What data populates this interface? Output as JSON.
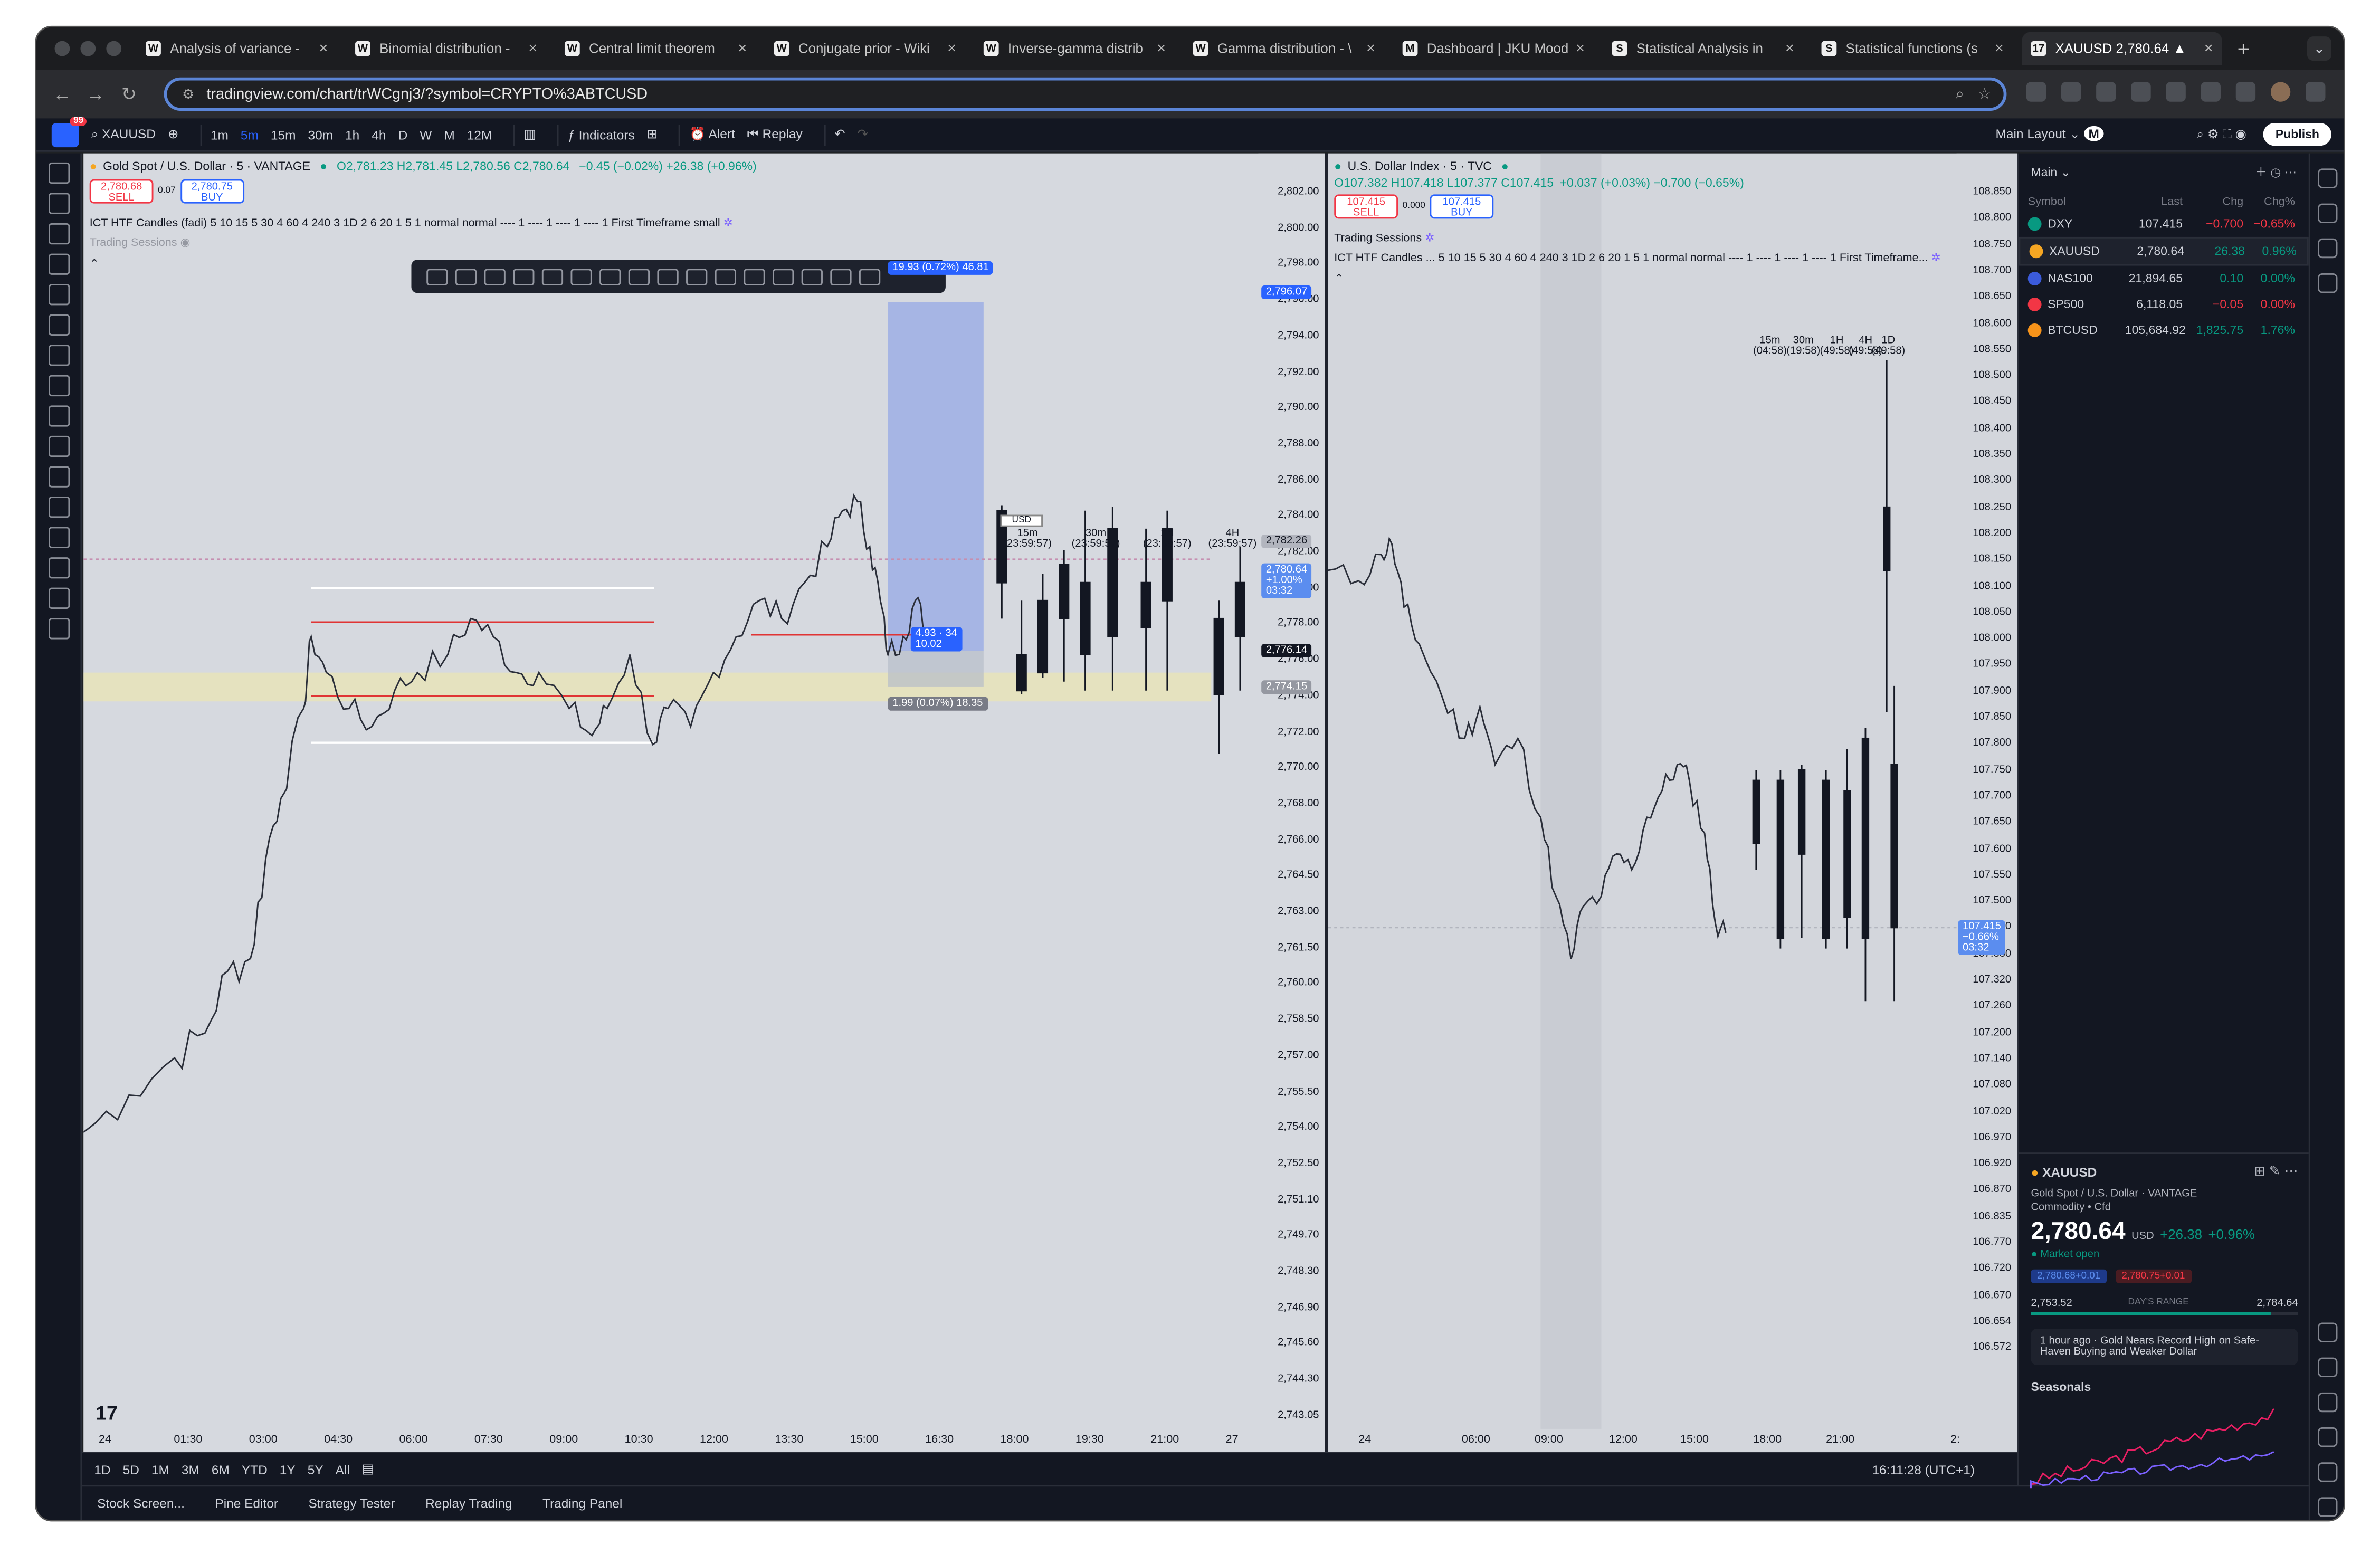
{
  "browser": {
    "tabs": [
      {
        "label": "Analysis of variance -",
        "fav": "W"
      },
      {
        "label": "Binomial distribution -",
        "fav": "W"
      },
      {
        "label": "Central limit theorem",
        "fav": "W"
      },
      {
        "label": "Conjugate prior - Wiki",
        "fav": "W"
      },
      {
        "label": "Inverse-gamma distrib",
        "fav": "W"
      },
      {
        "label": "Gamma distribution - \\",
        "fav": "W"
      },
      {
        "label": "Dashboard | JKU Mood",
        "fav": "M"
      },
      {
        "label": "Statistical Analysis in",
        "fav": "S"
      },
      {
        "label": "Statistical functions (s",
        "fav": "S"
      },
      {
        "label": "XAUUSD 2,780.64 ▲",
        "fav": "17"
      }
    ],
    "new_tab_icon": "+",
    "url": "tradingview.com/chart/trWCgnj3/?symbol=CRYPTO%3ABTCUSD"
  },
  "topbar": {
    "symbol": "XAUUSD",
    "timeframes": [
      "1m",
      "5m",
      "15m",
      "30m",
      "1h",
      "4h",
      "D",
      "W",
      "M",
      "12M"
    ],
    "selected_tf": "5m",
    "indicators": "Indicators",
    "alert": "Alert",
    "replay": "Replay",
    "layout": "Main Layout",
    "layout_badge": "M",
    "publish": "Publish",
    "notif_count": "99"
  },
  "chartL": {
    "title": "Gold Spot / U.S. Dollar · 5 · VANTAGE",
    "ohlc": "O2,781.23 H2,781.45 L2,780.56 C2,780.64",
    "change": "−0.45 (−0.02%) +26.38 (+0.96%)",
    "sell_price": "2,780.68",
    "sell": "SELL",
    "buy_price": "2,780.75",
    "buy": "BUY",
    "spread": "0.07",
    "indicator": "ICT HTF Candles (fadi)",
    "indicator_args": "5 10 15 5 30 4 60 4 240 3 1D 2 6 20 1 5 1 normal normal ---- 1 ---- 1 ---- 1 ---- 1 First Timeframe small",
    "sessions": "Trading Sessions",
    "currency": "USD",
    "price_scale": [
      "2,802.00",
      "2,800.00",
      "2,798.00",
      "2,796.00",
      "2,794.00",
      "2,792.00",
      "2,790.00",
      "2,788.00",
      "2,786.00",
      "2,784.00",
      "2,782.00",
      "2,780.00",
      "2,778.00",
      "2,776.00",
      "2,774.00",
      "2,772.00",
      "2,770.00",
      "2,768.00",
      "2,766.00",
      "2,764.50",
      "2,763.00",
      "2,761.50",
      "2,760.00",
      "2,758.50",
      "2,757.00",
      "2,755.50",
      "2,754.00",
      "2,752.50",
      "2,751.10",
      "2,749.70",
      "2,748.30",
      "2,746.90",
      "2,745.60",
      "2,744.30",
      "2,743.05"
    ],
    "time_axis": [
      "24",
      "01:30",
      "03:00",
      "04:30",
      "06:00",
      "07:30",
      "09:00",
      "10:30",
      "12:00",
      "13:30",
      "15:00",
      "16:30",
      "18:00",
      "19:30",
      "21:00",
      "27"
    ],
    "htf_labels": [
      {
        "tf": "15m",
        "t": "(23:59:57)"
      },
      {
        "tf": "30m",
        "t": "(23:59:57)"
      },
      {
        "tf": "1H",
        "t": "(23:59:57)"
      },
      {
        "tf": "4H",
        "t": "(23:59:57)"
      }
    ],
    "tags": {
      "p1": "2,796.07",
      "p2": "2,782.26",
      "last": "2,780.64",
      "last_chg": "+1.00%",
      "last_t": "03:32",
      "p3": "2,776.14",
      "p4": "2,774.15"
    },
    "pos_top": "19.93 (0.72%) 46.81",
    "pos_mid": "4.93 · 34\n10.02",
    "pos_bot": "1.99 (0.07%) 18.35"
  },
  "chartR": {
    "title": "U.S. Dollar Index · 5 · TVC",
    "ohlc": "O107.382 H107.418 L107.377 C107.415",
    "change": "+0.037 (+0.03%) −0.700 (−0.65%)",
    "sell_price": "107.415",
    "sell": "SELL",
    "buy_price": "107.415",
    "buy": "BUY",
    "spread": "0.000",
    "sessions": "Trading Sessions",
    "indicator": "ICT HTF Candles ...",
    "indicator_args": "5 10 15 5 30 4 60 4 240 3 1D 2 6 20 1 5 1 normal normal ---- 1 ---- 1 ---- 1 ---- 1 First Timeframe...",
    "currency": "USD",
    "price_scale": [
      "108.850",
      "108.800",
      "108.750",
      "108.700",
      "108.650",
      "108.600",
      "108.550",
      "108.500",
      "108.450",
      "108.400",
      "108.350",
      "108.300",
      "108.250",
      "108.200",
      "108.150",
      "108.100",
      "108.050",
      "108.000",
      "107.950",
      "107.900",
      "107.850",
      "107.800",
      "107.750",
      "107.700",
      "107.650",
      "107.600",
      "107.550",
      "107.500",
      "107.440",
      "107.380",
      "107.320",
      "107.260",
      "107.200",
      "107.140",
      "107.080",
      "107.020",
      "106.970",
      "106.920",
      "106.870",
      "106.835",
      "106.770",
      "106.720",
      "106.670",
      "106.654",
      "106.572"
    ],
    "time_axis": [
      "24",
      "06:00",
      "09:00",
      "12:00",
      "15:00",
      "18:00",
      "21:00",
      "2:"
    ],
    "htf_labels": [
      {
        "tf": "15m",
        "t": "(04:58)"
      },
      {
        "tf": "30m",
        "t": "(19:58)"
      },
      {
        "tf": "1H",
        "t": "(49:58)"
      },
      {
        "tf": "4H",
        "t": "(49:58)"
      },
      {
        "tf": "1D",
        "t": "(49:58)"
      }
    ],
    "tags": {
      "last": "107.415",
      "last_chg": "−0.66%",
      "last_t": "03:32"
    }
  },
  "bottom": {
    "ranges": [
      "1D",
      "5D",
      "1M",
      "3M",
      "6M",
      "YTD",
      "1Y",
      "5Y",
      "All"
    ],
    "clock": "16:11:28 (UTC+1)",
    "footer": [
      "Stock Screen...",
      "Pine Editor",
      "Strategy Tester",
      "Replay Trading",
      "Trading Panel"
    ]
  },
  "watchlist": {
    "title": "Main",
    "cols": [
      "Symbol",
      "Last",
      "Chg",
      "Chg%"
    ],
    "rows": [
      {
        "sym": "DXY",
        "last": "107.415",
        "chg": "−0.700",
        "pct": "−0.65%",
        "dir": "neg",
        "color": "#089981"
      },
      {
        "sym": "XAUUSD",
        "last": "2,780.64",
        "chg": "26.38",
        "pct": "0.96%",
        "dir": "pos",
        "color": "#f5a623"
      },
      {
        "sym": "NAS100",
        "last": "21,894.65",
        "chg": "0.10",
        "pct": "0.00%",
        "dir": "pos",
        "color": "#3b5bdb"
      },
      {
        "sym": "SP500",
        "last": "6,118.05",
        "chg": "−0.05",
        "pct": "0.00%",
        "dir": "neg",
        "color": "#f23645"
      },
      {
        "sym": "BTCUSD",
        "last": "105,684.92",
        "chg": "1,825.75",
        "pct": "1.76%",
        "dir": "pos",
        "color": "#f7931a"
      }
    ]
  },
  "details": {
    "sym": "XAUUSD",
    "name": "Gold Spot / U.S. Dollar",
    "exchange": "VANTAGE",
    "category": "Commodity • Cfd",
    "price": "2,780.64",
    "currency": "USD",
    "chg": "+26.38",
    "pct": "+0.96%",
    "status": "Market open",
    "bid": "2,780.68+0.01",
    "ask": "2,780.75+0.01",
    "low": "2,753.52",
    "high": "2,784.64",
    "range_label": "DAY'S RANGE",
    "range_fraction": 0.9,
    "news": "1 hour ago · Gold Nears Record High on Safe-Haven Buying and Weaker Dollar",
    "seasonals": "Seasonals"
  },
  "colors": {
    "up": "#089981",
    "down": "#f23645",
    "accent": "#2962ff"
  }
}
